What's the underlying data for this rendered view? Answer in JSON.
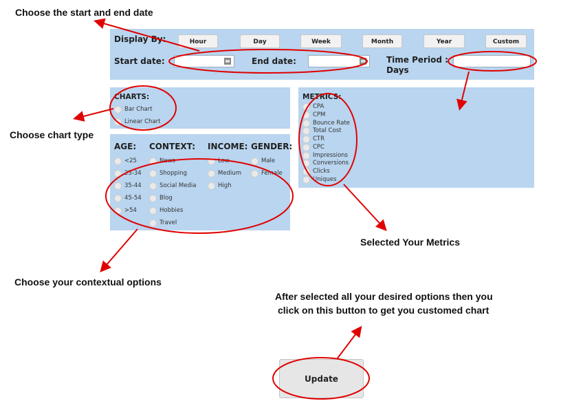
{
  "annotations": {
    "date": "Choose the start and end date",
    "chart_type": "Choose chart type",
    "contextual": "Choose your contextual options",
    "metrics": "Selected Your Metrics",
    "update_line1": "After selected all your desired options then you",
    "update_line2": "click on this button to get you customed chart"
  },
  "display_by": {
    "label": "Display By:",
    "buttons": [
      "Hour",
      "Day",
      "Week",
      "Month",
      "Year",
      "Custom"
    ]
  },
  "dates": {
    "start_label": "Start date:",
    "end_label": "End date:",
    "start_value": "",
    "end_value": "",
    "period_label_1": "Time Period :",
    "period_label_2": "Days",
    "period_value": ""
  },
  "charts": {
    "title": "CHARTS:",
    "options": [
      "Bar Chart",
      "Linear Chart"
    ]
  },
  "metrics": {
    "title": "METRICS:",
    "options": [
      "CPA",
      "CPM",
      "Bounce Rate",
      "Total Cost",
      "CTR",
      "CPC",
      "Impressions",
      "Conversions",
      "Clicks",
      "Uniques"
    ]
  },
  "context": {
    "age_title": "AGE:",
    "age": [
      "<25",
      "25-34",
      "35-44",
      "45-54",
      ">54"
    ],
    "context_title": "CONTEXT:",
    "context": [
      "News",
      "Shopping",
      "Social Media",
      "Blog",
      "Hobbies",
      "Travel"
    ],
    "income_title": "INCOME:",
    "income": [
      "Low",
      "Medium",
      "High"
    ],
    "gender_title": "GENDER:",
    "gender": [
      "Male",
      "Female"
    ]
  },
  "update_button": "Update",
  "colors": {
    "panel": "#b9d5ef",
    "annotation": "#e00000"
  }
}
